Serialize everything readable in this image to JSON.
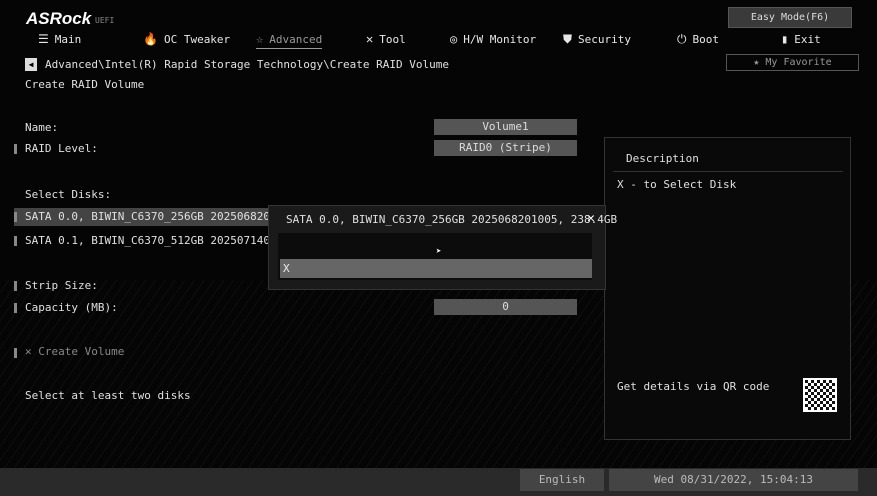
{
  "header": {
    "logo": "ASRock",
    "uefi": "UEFI",
    "easy_mode": "Easy Mode(F6)",
    "my_favorite": "My Favorite"
  },
  "tabs": [
    {
      "label": "Main",
      "icon": "☰"
    },
    {
      "label": "OC Tweaker",
      "icon": "🔥"
    },
    {
      "label": "Advanced",
      "icon": "☆"
    },
    {
      "label": "Tool",
      "icon": "✕"
    },
    {
      "label": "H/W Monitor",
      "icon": "◎"
    },
    {
      "label": "Security",
      "icon": "⛊"
    },
    {
      "label": "Boot",
      "icon": "⏻"
    },
    {
      "label": "Exit",
      "icon": "▮"
    }
  ],
  "breadcrumb": "Advanced\\Intel(R) Rapid Storage Technology\\Create RAID Volume",
  "page_title": "Create RAID Volume",
  "form": {
    "name_label": "Name:",
    "name_value": "Volume1",
    "raid_label": "RAID Level:",
    "raid_value": "RAID0 (Stripe)",
    "select_disks": "Select Disks:",
    "disk1": "SATA 0.0, BIWIN_C6370_256GB 2025068201005",
    "disk2": "SATA 0.1, BIWIN_C6370_512GB 2025071401003",
    "strip_label": "Strip Size:",
    "capacity_label": "Capacity (MB):",
    "capacity_value": "0",
    "create_volume": "Create Volume",
    "hint": "Select at least two disks"
  },
  "popup": {
    "title": "SATA 0.0, BIWIN_C6370_256GB 2025068201005, 238.4GB",
    "option": "X"
  },
  "description": {
    "title": "Description",
    "text": "X - to Select Disk",
    "qr_text": "Get details via QR code"
  },
  "footer": {
    "language": "English",
    "datetime": "Wed 08/31/2022, 15:04:13"
  }
}
